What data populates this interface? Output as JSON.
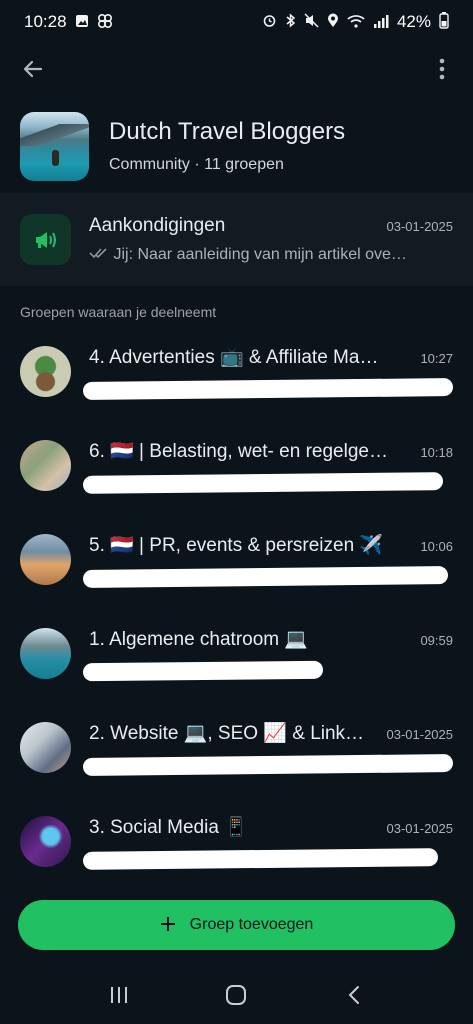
{
  "status": {
    "time": "10:28",
    "battery": "42%",
    "left_icons": [
      "image-icon",
      "pinwheel-icon"
    ],
    "right_icons": [
      "alarm-icon",
      "bluetooth-icon",
      "mute-icon",
      "location-icon",
      "wifi-icon",
      "signal-icon",
      "battery-icon"
    ]
  },
  "topbar": {
    "back_icon": "arrow-left-icon",
    "menu_icon": "more-vertical-icon"
  },
  "community": {
    "name": "Dutch Travel Bloggers",
    "subtitle": "Community · 11 groepen"
  },
  "announcements": {
    "title": "Aankondigingen",
    "date": "03-01-2025",
    "preview": "Jij: Naar aanleiding van mijn artikel ove…",
    "icon": "megaphone-icon",
    "read_icon": "double-check-icon"
  },
  "section_label": "Groepen waaraan je deelneemt",
  "groups": [
    {
      "title": "4. Advertenties 📺 & Affiliate Ma…",
      "time": "10:27"
    },
    {
      "title": "6. 🇳🇱 | Belasting, wet- en regelge…",
      "time": "10:18"
    },
    {
      "title": "5. 🇳🇱 | PR, events & persreizen ✈️",
      "time": "10:06"
    },
    {
      "title": "1. Algemene chatroom 💻",
      "time": "09:59"
    },
    {
      "title": "2. Website 💻, SEO 📈 & Link…",
      "time": "03-01-2025"
    },
    {
      "title": "3. Social Media 📱",
      "time": "03-01-2025"
    }
  ],
  "add_group": {
    "label": "Groep toevoegen",
    "icon": "plus-icon"
  },
  "colors": {
    "background": "#0b141a",
    "accent": "#21c063",
    "announce_bg": "#111b21"
  }
}
